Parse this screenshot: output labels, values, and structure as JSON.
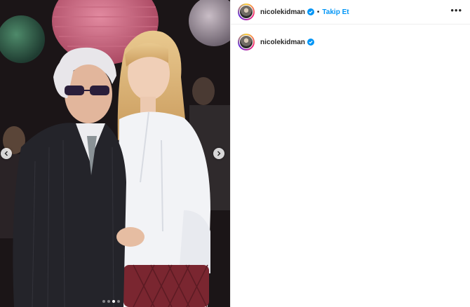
{
  "post": {
    "username": "nicolekidman",
    "follow_label": "Takip Et",
    "separator": "•",
    "more_label": "•••",
    "caption_username": "nicolekidman",
    "carousel": {
      "slide_count": 4,
      "active_index": 2
    }
  },
  "icons": {
    "verified": "verified-badge-icon",
    "prev": "chevron-left-icon",
    "next": "chevron-right-icon",
    "more": "more-options-icon"
  },
  "colors": {
    "accent": "#0095f6",
    "text": "#262626",
    "divider": "#efefef"
  }
}
